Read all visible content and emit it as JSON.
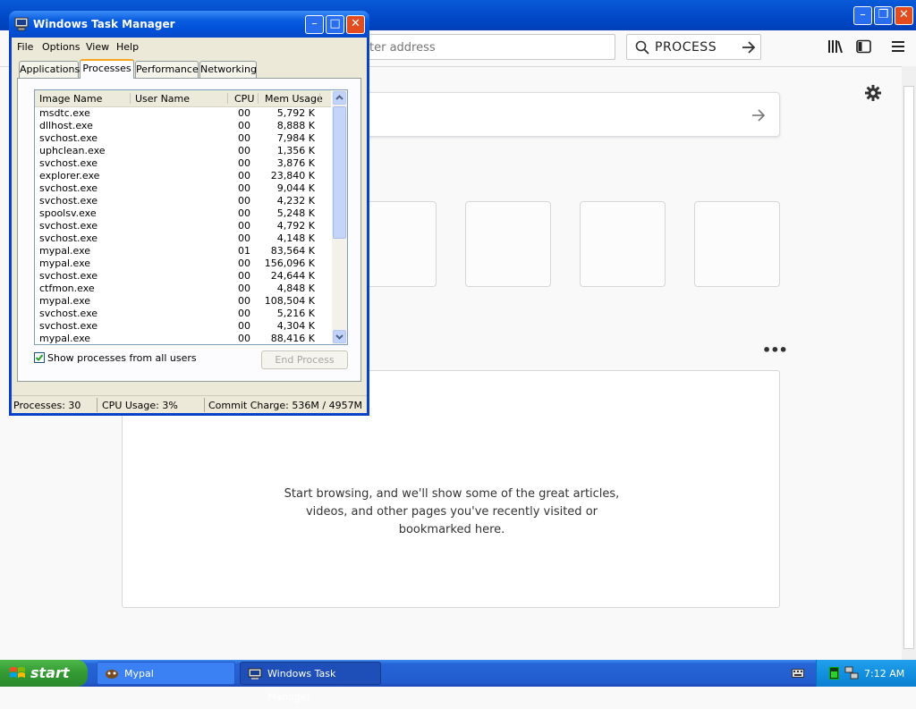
{
  "browser": {
    "url_placeholder": "ter address",
    "search_text": "PROCESS",
    "empty_message_line1": "Start browsing, and we'll show some of the great articles,",
    "empty_message_line2": "videos, and other pages you've recently visited or",
    "empty_message_line3": "bookmarked here.",
    "more_label": "•••",
    "window_buttons": {
      "minimize": "–",
      "restore": "❐",
      "close": "✕"
    }
  },
  "task_manager": {
    "title": "Windows Task Manager",
    "menu": [
      "File",
      "Options",
      "View",
      "Help"
    ],
    "tabs": [
      "Applications",
      "Processes",
      "Performance",
      "Networking"
    ],
    "active_tab": "Processes",
    "columns": [
      "Image Name",
      "User Name",
      "CPU",
      "Mem Usage"
    ],
    "processes": [
      {
        "name": "msdtc.exe",
        "cpu": "00",
        "mem": "5,792 K"
      },
      {
        "name": "dllhost.exe",
        "cpu": "00",
        "mem": "8,888 K"
      },
      {
        "name": "svchost.exe",
        "cpu": "00",
        "mem": "7,984 K"
      },
      {
        "name": "uphclean.exe",
        "cpu": "00",
        "mem": "1,356 K"
      },
      {
        "name": "svchost.exe",
        "cpu": "00",
        "mem": "3,876 K"
      },
      {
        "name": "explorer.exe",
        "cpu": "00",
        "mem": "23,840 K"
      },
      {
        "name": "svchost.exe",
        "cpu": "00",
        "mem": "9,044 K"
      },
      {
        "name": "svchost.exe",
        "cpu": "00",
        "mem": "4,232 K"
      },
      {
        "name": "spoolsv.exe",
        "cpu": "00",
        "mem": "5,248 K"
      },
      {
        "name": "svchost.exe",
        "cpu": "00",
        "mem": "4,792 K"
      },
      {
        "name": "svchost.exe",
        "cpu": "00",
        "mem": "4,148 K"
      },
      {
        "name": "mypal.exe",
        "cpu": "01",
        "mem": "83,564 K"
      },
      {
        "name": "mypal.exe",
        "cpu": "00",
        "mem": "156,096 K"
      },
      {
        "name": "svchost.exe",
        "cpu": "00",
        "mem": "24,644 K"
      },
      {
        "name": "ctfmon.exe",
        "cpu": "00",
        "mem": "4,848 K"
      },
      {
        "name": "mypal.exe",
        "cpu": "00",
        "mem": "108,504 K"
      },
      {
        "name": "svchost.exe",
        "cpu": "00",
        "mem": "5,216 K"
      },
      {
        "name": "svchost.exe",
        "cpu": "00",
        "mem": "4,304 K"
      },
      {
        "name": "mypal.exe",
        "cpu": "00",
        "mem": "88,416 K"
      }
    ],
    "show_all_label": "Show processes from all users",
    "show_all_checked": true,
    "end_process_label": "End Process",
    "status": {
      "processes": "Processes: 30",
      "cpu": "CPU Usage: 3%",
      "commit": "Commit Charge: 536M / 4957M"
    }
  },
  "taskbar": {
    "start_label": "start",
    "items": [
      {
        "label": "Mypal",
        "active": false
      },
      {
        "label": "Windows Task Manager",
        "active": true
      }
    ],
    "clock": "7:12 AM"
  }
}
